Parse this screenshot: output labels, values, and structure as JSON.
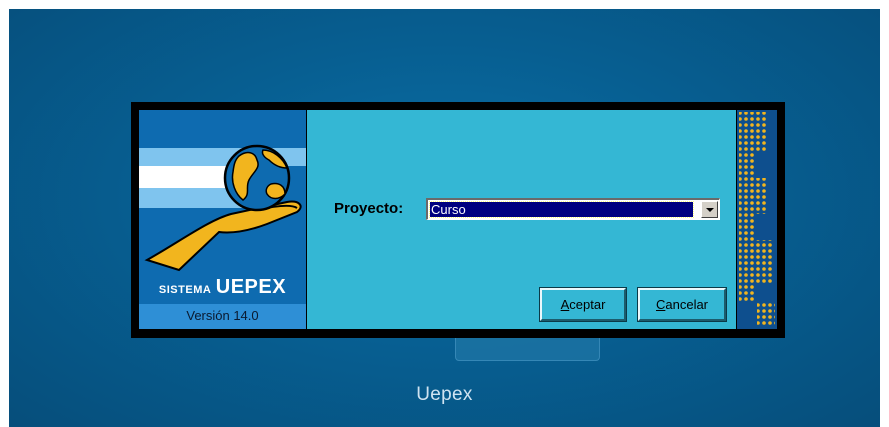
{
  "window": {
    "caption": "Uepex"
  },
  "logo": {
    "system_small": "SISTEMA",
    "system_big": "UEPEX",
    "version": "Versión 14.0"
  },
  "form": {
    "project_label": "Proyecto:",
    "project_value": "Curso"
  },
  "buttons": {
    "accept_label": "Aceptar",
    "cancel_label": "Cancelar"
  },
  "colors": {
    "desktop": "#075f92",
    "panel": "#34b7d4",
    "logo_bg": "#0e6bb0",
    "accent_gold": "#f2b51e",
    "selection": "#000080"
  }
}
